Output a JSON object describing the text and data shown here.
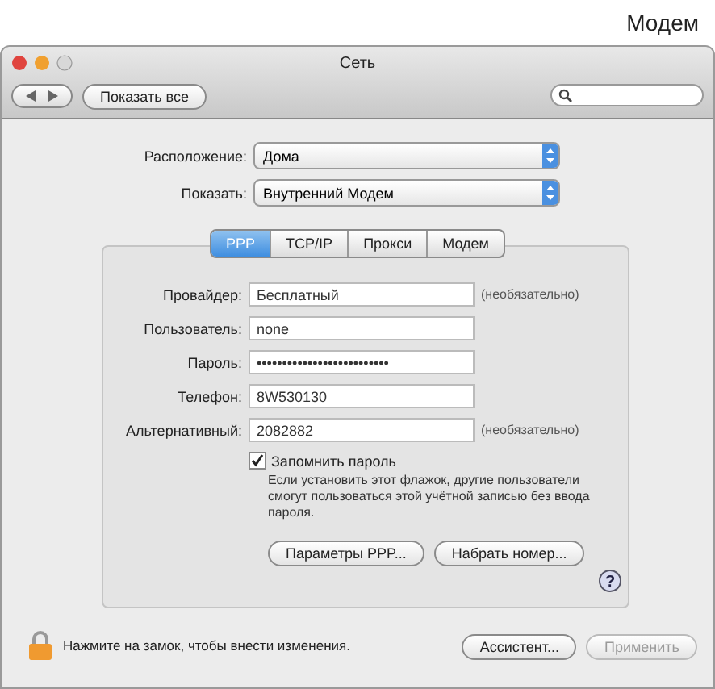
{
  "caption": "Модем",
  "window": {
    "title": "Сеть"
  },
  "toolbar": {
    "show_all": "Показать все"
  },
  "popups": [
    {
      "label": "Расположение:",
      "value": "Дома"
    },
    {
      "label": "Показать:",
      "value": "Внутренний Модем"
    }
  ],
  "tabs": [
    {
      "label": "PPP",
      "selected": true
    },
    {
      "label": "TCP/IP",
      "selected": false
    },
    {
      "label": "Прокси",
      "selected": false
    },
    {
      "label": "Модем",
      "selected": false
    }
  ],
  "fields": [
    {
      "label": "Провайдер:",
      "value": "Бесплатный",
      "note": "(необязательно)"
    },
    {
      "label": "Пользователь:",
      "value": "none"
    },
    {
      "label": "Пароль:",
      "value": "••••••••••••••••••••••••••"
    },
    {
      "label": "Телефон:",
      "value": "8W530130"
    },
    {
      "label": "Альтернативный:",
      "value": "2082882",
      "note": "(необязательно)"
    }
  ],
  "remember": {
    "label": "Запомнить пароль",
    "checked": true,
    "hint": "Если установить этот флажок, другие пользователи смогут пользоваться этой учётной записью без ввода пароля."
  },
  "panel_buttons": [
    {
      "label": "Параметры PPP..."
    },
    {
      "label": "Набрать номер..."
    }
  ],
  "help": "?",
  "lock_text": "Нажмите на замок, чтобы внести изменения.",
  "bottom_buttons": [
    {
      "label": "Ассистент...",
      "disabled": false
    },
    {
      "label": "Применить",
      "disabled": true
    }
  ]
}
